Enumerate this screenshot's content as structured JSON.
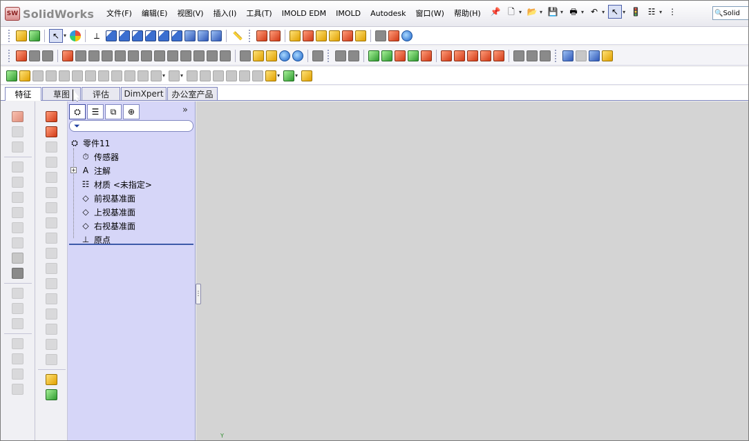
{
  "app": {
    "brand": "SolidWorks",
    "logo_badge": "SW"
  },
  "menu": {
    "items": [
      "文件(F)",
      "编辑(E)",
      "视图(V)",
      "插入(I)",
      "工具(T)",
      "IMOLD EDM",
      "IMOLD",
      "Autodesk",
      "窗口(W)",
      "帮助(H)"
    ]
  },
  "search": {
    "value": "Solid"
  },
  "command_tabs": {
    "items": [
      "特征",
      "草图",
      "评估",
      "DimXpert",
      "办公室产品"
    ],
    "active": "特征"
  },
  "feature_manager": {
    "tabs": [
      "feature-tree",
      "property-manager",
      "configuration-manager",
      "dimxpert-manager"
    ],
    "filter_placeholder": "",
    "tree": {
      "root": "零件11",
      "items": [
        {
          "label": "传感器",
          "icon": "sensor-icon",
          "expandable": false
        },
        {
          "label": "注解",
          "icon": "annotation-icon",
          "expandable": true
        },
        {
          "label": "材质 <未指定>",
          "icon": "material-icon",
          "expandable": false
        },
        {
          "label": "前视基准面",
          "icon": "plane-icon",
          "expandable": false
        },
        {
          "label": "上视基准面",
          "icon": "plane-icon",
          "expandable": false
        },
        {
          "label": "右视基准面",
          "icon": "plane-icon",
          "expandable": false
        },
        {
          "label": "原点",
          "icon": "origin-icon",
          "expandable": false
        }
      ]
    }
  },
  "viewport": {
    "axis_label": "Y"
  },
  "colors": {
    "feature_panel_bg": "#d6d6f8",
    "viewport_bg": "#d4d4d4",
    "tab_border": "#7f86c0"
  }
}
